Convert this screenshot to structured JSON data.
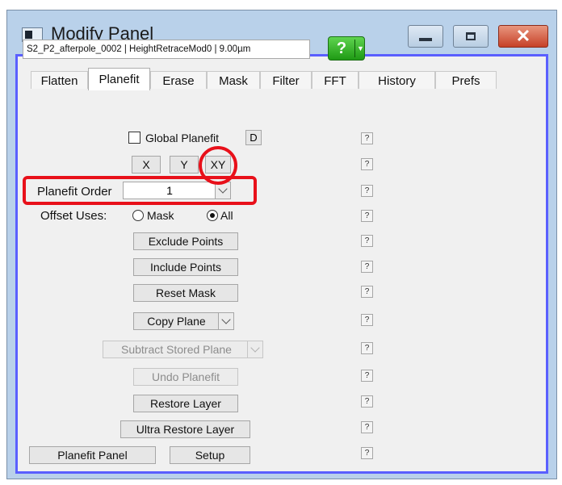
{
  "window": {
    "title": "Modify Panel",
    "icons": [
      "app-window-icon",
      "minimize-icon",
      "maximize-icon",
      "close-icon"
    ]
  },
  "tabs": [
    {
      "label": "Flatten"
    },
    {
      "label": "Planefit",
      "active": true
    },
    {
      "label": "Erase"
    },
    {
      "label": "Mask"
    },
    {
      "label": "Filter"
    },
    {
      "label": "FFT"
    },
    {
      "label": "History"
    },
    {
      "label": "Prefs"
    }
  ],
  "info": {
    "text": "S2_P2_afterpole_0002 | HeightRetraceMod0 | 9.00µm",
    "help_button": "?"
  },
  "global_planefit": {
    "label": "Global Planefit",
    "checked": false,
    "d_button": "D"
  },
  "axis_buttons": {
    "x": "X",
    "y": "Y",
    "xy": "XY"
  },
  "planefit_order": {
    "label": "Planefit Order",
    "value": "1"
  },
  "offset_uses": {
    "label": "Offset Uses:",
    "options": [
      "Mask",
      "All"
    ],
    "selected": "All"
  },
  "buttons": {
    "exclude_points": "Exclude Points",
    "include_points": "Include Points",
    "reset_mask": "Reset Mask",
    "copy_plane": "Copy Plane",
    "subtract_stored_plane": "Subtract Stored Plane",
    "undo_planefit": "Undo Planefit",
    "restore_layer": "Restore Layer",
    "ultra_restore_layer": "Ultra Restore Layer",
    "planefit_panel": "Planefit Panel",
    "setup": "Setup"
  },
  "help_glyph": "?",
  "colors": {
    "highlight": "#e8101a",
    "panel_border": "#5a5fff",
    "help_green": "#1f9a14",
    "close_red": "#c64128"
  }
}
